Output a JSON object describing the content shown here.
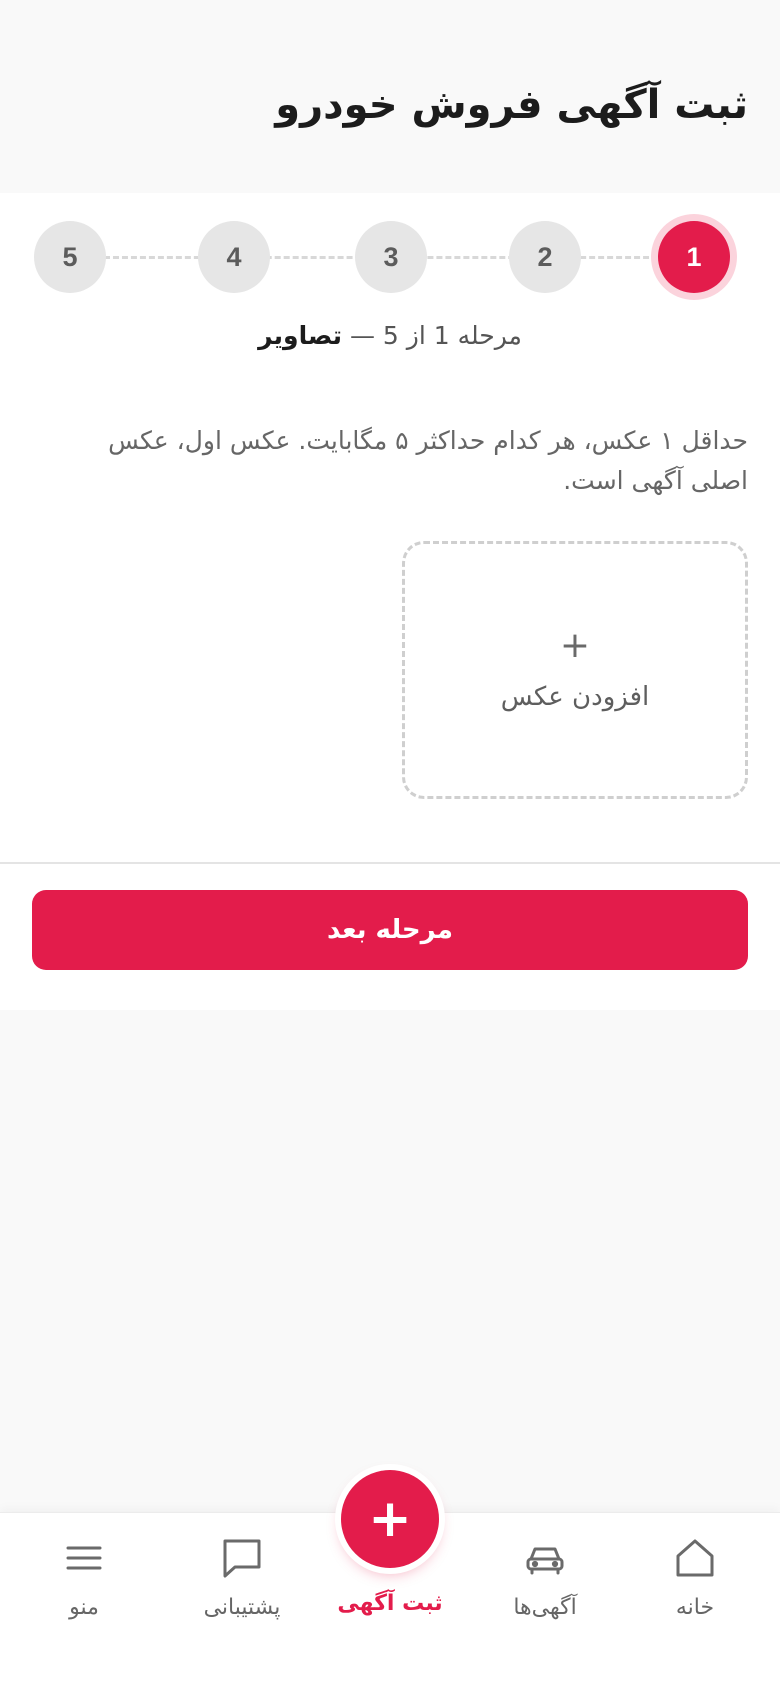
{
  "header": {
    "title": "ثبت آگهی فروش خودرو"
  },
  "stepper": {
    "steps": [
      "1",
      "2",
      "3",
      "4",
      "5"
    ],
    "current": 1,
    "total": 5,
    "caption_prefix": "مرحله 1 از 5 —",
    "caption_step_name": "تصاویر"
  },
  "photos": {
    "hint": "حداقل ۱ عکس، هر کدام حداکثر ۵ مگابایت. عکس اول، عکس اصلی آگهی است.",
    "add_icon": "plus-icon",
    "add_label": "افزودن عکس"
  },
  "actions": {
    "next_label": "مرحله بعد"
  },
  "bottom_nav": {
    "items": [
      {
        "label": "خانه",
        "icon": "home-icon"
      },
      {
        "label": "آگهی‌ها",
        "icon": "car-icon"
      },
      {
        "label": "ثبت آگهی",
        "icon": "plus-icon"
      },
      {
        "label": "پشتیبانی",
        "icon": "chat-icon"
      },
      {
        "label": "منو",
        "icon": "menu-icon"
      }
    ]
  },
  "colors": {
    "accent": "#e31c4b",
    "accent_light": "#fbd3dc",
    "inactive_step": "#e6e6e6"
  }
}
